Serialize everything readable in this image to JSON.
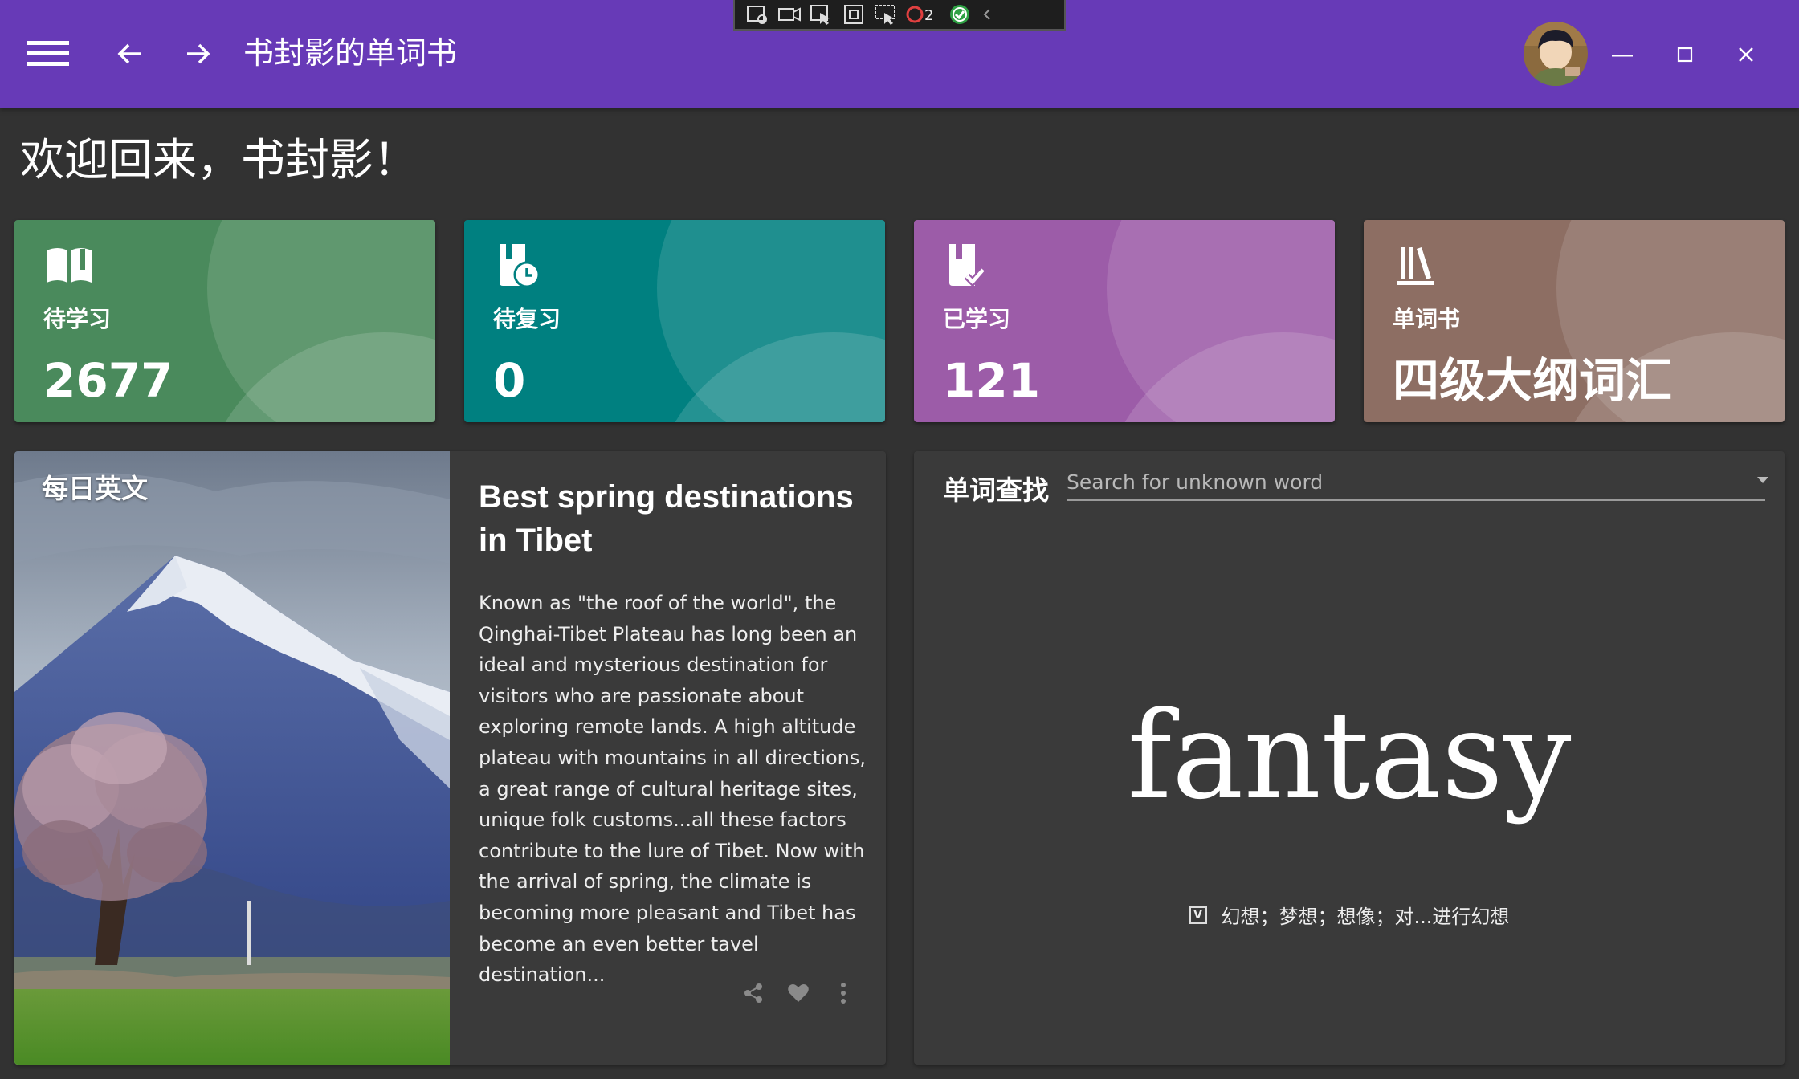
{
  "app": {
    "title": "书封影的单词书",
    "debug_badge_count": "2"
  },
  "welcome": "欢迎回来，书封影！",
  "stats": [
    {
      "label": "待学习",
      "value": "2677",
      "color": "#4a8a5c",
      "icon": "book-open-icon"
    },
    {
      "label": "待复习",
      "value": "0",
      "color": "#008080",
      "icon": "book-clock-icon"
    },
    {
      "label": "已学习",
      "value": "121",
      "color": "#9c5ca8",
      "icon": "book-check-icon"
    },
    {
      "label": "单词书",
      "value": "四级大纲词汇",
      "color": "#8d6e63",
      "icon": "library-icon"
    }
  ],
  "daily": {
    "tag": "每日英文",
    "title": "Best spring destinations in Tibet",
    "body": "Known as \"the roof of the world\", the Qinghai-Tibet Plateau has long been an ideal and mysterious destination for visitors who are passionate about exploring remote lands. A high altitude plateau with mountains in all directions, a great range of cultural heritage sites, unique folk customs...all these factors contribute to the lure of Tibet. Now with the arrival of spring, the climate is becoming more pleasant and Tibet has become an even better tavel destination..."
  },
  "lookup": {
    "label": "单词查找",
    "placeholder": "Search for unknown word",
    "word": "fantasy",
    "pos": "V",
    "meaning": "幻想；梦想；想像；对...进行幻想"
  }
}
